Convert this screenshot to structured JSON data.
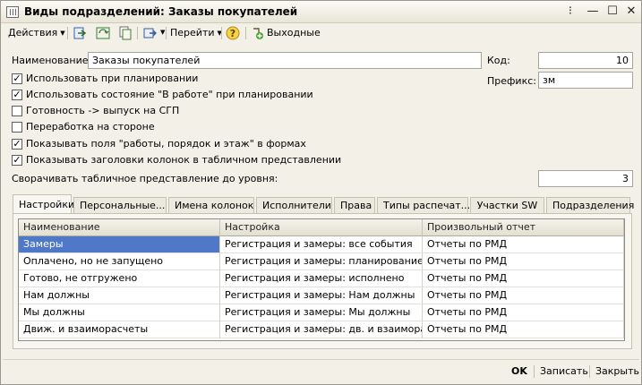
{
  "window": {
    "title": "Виды подразделений: Заказы покупателей"
  },
  "toolbar": {
    "actions_label": "Действия",
    "goto_label": "Перейти",
    "weekends_label": "Выходные"
  },
  "form": {
    "name_label": "Наименование:",
    "name_value": "Заказы покупателей",
    "code_label": "Код:",
    "code_value": "10",
    "prefix_label": "Префикс:",
    "prefix_value": "зм",
    "checkboxes": [
      {
        "label": "Использовать при планировании",
        "checked": true
      },
      {
        "label": "Использовать состояние \"В работе\" при планировании",
        "checked": true
      },
      {
        "label": "Готовность -> выпуск на СГП",
        "checked": false
      },
      {
        "label": "Переработка на стороне",
        "checked": false
      },
      {
        "label": "Показывать поля \"работы, порядок и этаж\" в формах",
        "checked": true
      },
      {
        "label": "Показывать заголовки колонок в табличном представлении",
        "checked": true
      }
    ],
    "collapse_label": "Сворачивать табличное представление до уровня:",
    "collapse_value": "3"
  },
  "tabs": [
    {
      "label": "Настройки",
      "active": true
    },
    {
      "label": "Персональные...",
      "active": false
    },
    {
      "label": "Имена колонок",
      "active": false
    },
    {
      "label": "Исполнители",
      "active": false
    },
    {
      "label": "Права",
      "active": false
    },
    {
      "label": "Типы распечат...",
      "active": false
    },
    {
      "label": "Участки SW",
      "active": false
    },
    {
      "label": "Подразделения",
      "active": false
    }
  ],
  "table": {
    "columns": [
      "Наименование",
      "Настройка",
      "Произвольный отчет"
    ],
    "rows": [
      [
        "Замеры",
        "Регистрация и замеры: все события",
        "Отчеты по РМД"
      ],
      [
        "Оплачено, но не запущено",
        "Регистрация и замеры: планирование",
        "Отчеты по РМД"
      ],
      [
        "Готово, не отгружено",
        "Регистрация и замеры: исполнено",
        "Отчеты по РМД"
      ],
      [
        "Нам должны",
        "Регистрация и замеры: Нам должны",
        "Отчеты по РМД"
      ],
      [
        "Мы должны",
        "Регистрация и замеры: Мы должны",
        "Отчеты по РМД"
      ],
      [
        "Движ. и взаиморасчеты",
        "Регистрация и замеры: дв. и взаиморас...",
        "Отчеты по РМД"
      ]
    ]
  },
  "footer": {
    "ok_label": "OK",
    "save_label": "Записать",
    "close_label": "Закрыть"
  },
  "colors": {
    "window_bg": "#f3f1e7",
    "selection": "#4f78c8"
  }
}
